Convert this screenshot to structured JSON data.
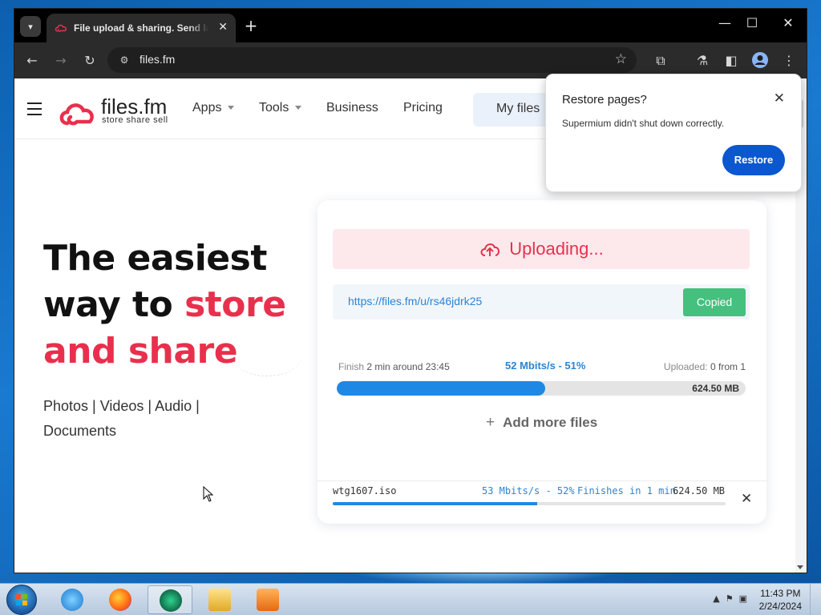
{
  "browser": {
    "tab_title": "File upload & sharing. Send large files",
    "url": "files.fm"
  },
  "site": {
    "logo_name": "files.fm",
    "logo_tagline": "store share sell",
    "nav": [
      {
        "label": "Apps",
        "dropdown": true
      },
      {
        "label": "Tools",
        "dropdown": true
      },
      {
        "label": "Business",
        "dropdown": false
      },
      {
        "label": "Pricing",
        "dropdown": false
      }
    ],
    "my_files_label": "My files"
  },
  "hero": {
    "line1": "The easiest",
    "line2_plain": "way to ",
    "line2_accent": "store",
    "line3_accent": "and share",
    "sub_line1": "Photos | Videos | Audio |",
    "sub_line2": "Documents"
  },
  "upload": {
    "status": "Uploading...",
    "share_link": "https://files.fm/u/rs46jdrk25",
    "copied_label": "Copied",
    "finish_prefix": "Finish",
    "finish_value": "2 min around 23:45",
    "speed_summary": "52 Mbits/s - 51%",
    "uploaded_prefix": "Uploaded:",
    "uploaded_value": "0 from 1",
    "total_size": "624.50 MB",
    "progress_percent": 51,
    "add_more_label": "Add more files",
    "file": {
      "name": "wtg1607.iso",
      "speed": "53 Mbits/s - 52%",
      "finish": "Finishes in 1 min",
      "size": "624.50 MB",
      "progress_percent": 52
    }
  },
  "restore_dialog": {
    "title": "Restore pages?",
    "message": "Supermium didn't shut down correctly.",
    "button": "Restore"
  },
  "taskbar": {
    "time": "11:43 PM",
    "date": "2/24/2024"
  },
  "colors": {
    "accent_red": "#e8304d",
    "progress_blue": "#1f88e5",
    "copied_green": "#45c07e",
    "restore_blue": "#0b57d0"
  }
}
